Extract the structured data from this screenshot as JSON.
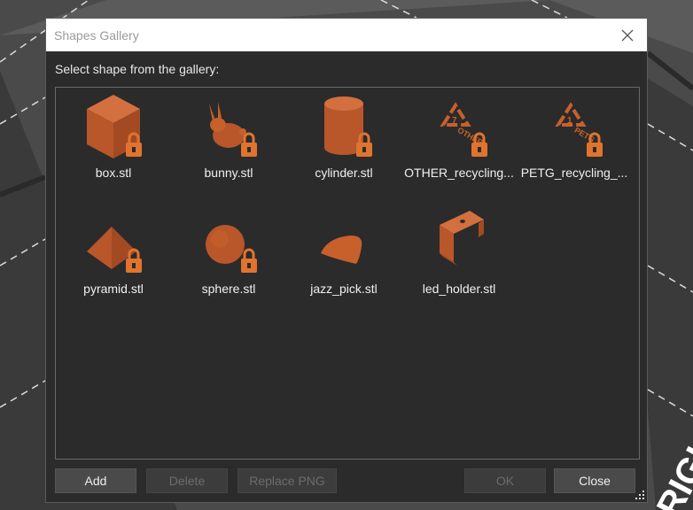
{
  "dialog": {
    "title": "Shapes Gallery",
    "prompt": "Select shape from the gallery:"
  },
  "colors": {
    "shape": "#c8602c",
    "lock": "#e0742f",
    "accent": "#ffffff"
  },
  "shapes": [
    {
      "label": "box.stl",
      "icon": "box-shape-icon",
      "locked": true
    },
    {
      "label": "bunny.stl",
      "icon": "bunny-shape-icon",
      "locked": true
    },
    {
      "label": "cylinder.stl",
      "icon": "cylinder-shape-icon",
      "locked": true
    },
    {
      "label": "OTHER_recycling...",
      "icon": "other-recycling-shape-icon",
      "locked": true,
      "emboss": "OTHER"
    },
    {
      "label": "PETG_recycling_...",
      "icon": "petg-recycling-shape-icon",
      "locked": true,
      "emboss": "PETG"
    },
    {
      "label": "pyramid.stl",
      "icon": "pyramid-shape-icon",
      "locked": true
    },
    {
      "label": "sphere.stl",
      "icon": "sphere-shape-icon",
      "locked": true
    },
    {
      "label": "jazz_pick.stl",
      "icon": "jazz-pick-shape-icon",
      "locked": false
    },
    {
      "label": "led_holder.stl",
      "icon": "led-holder-shape-icon",
      "locked": false
    }
  ],
  "buttons": {
    "add": "Add",
    "delete": "Delete",
    "replace_png": "Replace PNG",
    "ok": "OK",
    "close": "Close"
  },
  "background_text": "RIGH"
}
